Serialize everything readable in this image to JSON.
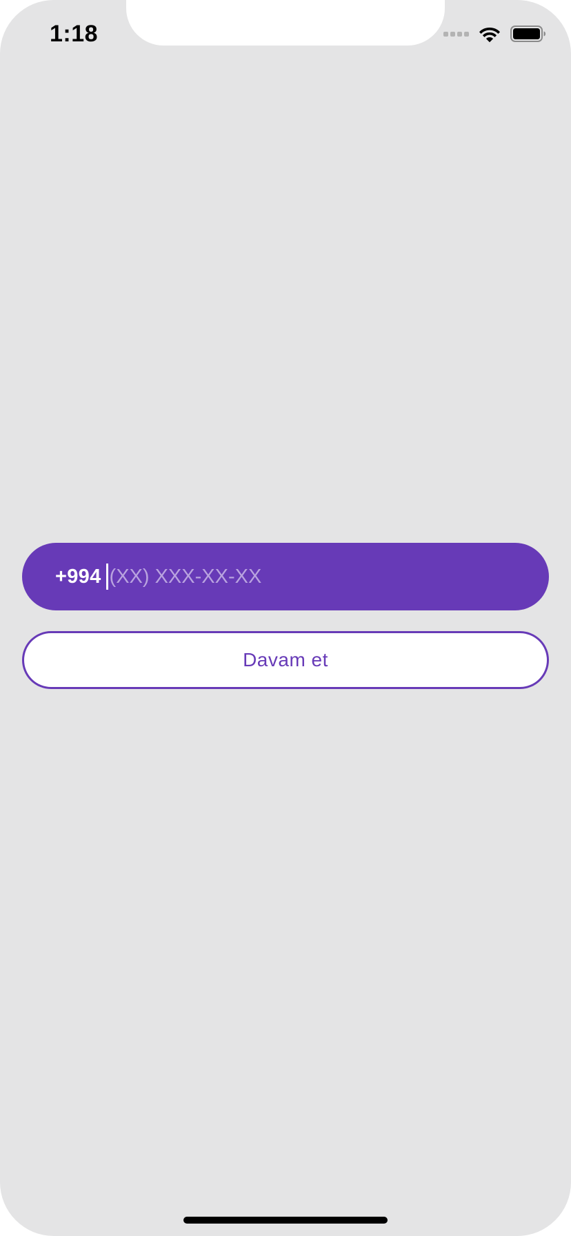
{
  "status_bar": {
    "time": "1:18",
    "icons": [
      "cellular-signal-icon",
      "wifi-icon",
      "battery-icon"
    ]
  },
  "phone_input": {
    "prefix": "+994",
    "value": "",
    "placeholder": "(XX) XXX-XX-XX"
  },
  "continue_button": {
    "label": "Davam et"
  },
  "colors": {
    "background": "#e4e4e5",
    "accent": "#673ab7",
    "placeholder": "#b9a3df",
    "button_background": "#ffffff"
  }
}
